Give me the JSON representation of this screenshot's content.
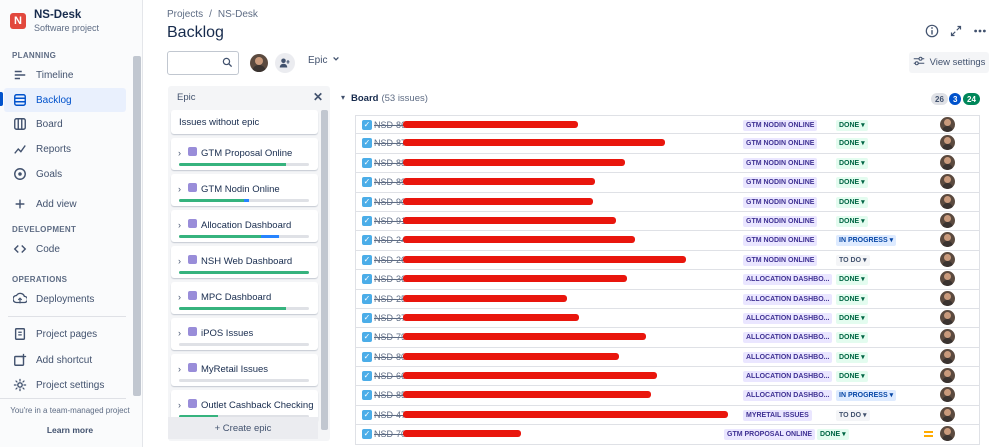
{
  "project": {
    "name": "NS-Desk",
    "type": "Software project",
    "logo_letter": "N"
  },
  "sidebar": {
    "planning_title": "PLANNING",
    "planning": [
      {
        "label": "Timeline",
        "icon": "timeline-icon"
      },
      {
        "label": "Backlog",
        "icon": "backlog-icon",
        "active": true
      },
      {
        "label": "Board",
        "icon": "board-icon"
      },
      {
        "label": "Reports",
        "icon": "reports-icon"
      },
      {
        "label": "Goals",
        "icon": "goals-icon"
      },
      {
        "label": "Add view",
        "icon": "plus-icon"
      }
    ],
    "development_title": "DEVELOPMENT",
    "development": [
      {
        "label": "Code",
        "icon": "code-icon"
      }
    ],
    "operations_title": "OPERATIONS",
    "operations": [
      {
        "label": "Deployments",
        "icon": "deployments-icon"
      }
    ],
    "bottom": [
      {
        "label": "Project pages",
        "icon": "pages-icon"
      },
      {
        "label": "Add shortcut",
        "icon": "shortcut-icon"
      },
      {
        "label": "Project settings",
        "icon": "settings-icon"
      }
    ],
    "footer_text": "You're in a team-managed project",
    "learn_more": "Learn more"
  },
  "breadcrumb": [
    "Projects",
    "/",
    "NS-Desk"
  ],
  "page_title": "Backlog",
  "toolbar": {
    "epic_filter": "Epic",
    "view_settings": "View settings"
  },
  "epic_panel": {
    "title": "Epic",
    "without_epic": "Issues without epic",
    "epics": [
      {
        "name": "GTM Proposal Online",
        "done": 0.82,
        "inprogress": 0.0
      },
      {
        "name": "GTM Nodin Online",
        "done": 0.5,
        "inprogress": 0.04
      },
      {
        "name": "Allocation Dashboard",
        "done": 0.63,
        "inprogress": 0.14
      },
      {
        "name": "NSH Web Dashboard",
        "done": 1.0,
        "inprogress": 0.0
      },
      {
        "name": "MPC Dashboard",
        "done": 0.82,
        "inprogress": 0.0
      },
      {
        "name": "iPOS Issues",
        "done": 0.0,
        "inprogress": 0.0
      },
      {
        "name": "MyRetail Issues",
        "done": 0.0,
        "inprogress": 0.0
      },
      {
        "name": "Outlet Cashback Checking",
        "done": 0.3,
        "inprogress": 0.0
      }
    ],
    "create_epic": "+ Create epic"
  },
  "board": {
    "title": "Board",
    "count_text": "(53 issues)",
    "counts": {
      "todo": "26",
      "inprogress": "3",
      "done": "24"
    },
    "colors": {
      "todo": "#dfe1e6",
      "inprogress": "#0052cc",
      "done": "#00875a"
    },
    "issues": [
      {
        "key": "NSD-86",
        "epic": "GTM NODIN ONLINE",
        "status": "DONE",
        "kind": "done"
      },
      {
        "key": "NSD-87",
        "epic": "GTM NODIN ONLINE",
        "status": "DONE",
        "kind": "done"
      },
      {
        "key": "NSD-88",
        "epic": "GTM NODIN ONLINE",
        "status": "DONE",
        "kind": "done"
      },
      {
        "key": "NSD-89",
        "epic": "GTM NODIN ONLINE",
        "status": "DONE",
        "kind": "done"
      },
      {
        "key": "NSD-90",
        "epic": "GTM NODIN ONLINE",
        "status": "DONE",
        "kind": "done"
      },
      {
        "key": "NSD-91",
        "epic": "GTM NODIN ONLINE",
        "status": "DONE",
        "kind": "done"
      },
      {
        "key": "NSD-24",
        "epic": "GTM NODIN ONLINE",
        "status": "IN PROGRESS",
        "kind": "prog"
      },
      {
        "key": "NSD-26",
        "epic": "GTM NODIN ONLINE",
        "status": "TO DO",
        "kind": "todo"
      },
      {
        "key": "NSD-36",
        "epic": "ALLOCATION DASHBO...",
        "status": "DONE",
        "kind": "done"
      },
      {
        "key": "NSD-25",
        "epic": "ALLOCATION DASHBO...",
        "status": "DONE",
        "kind": "done"
      },
      {
        "key": "NSD-37",
        "epic": "ALLOCATION DASHBO...",
        "status": "DONE",
        "kind": "done"
      },
      {
        "key": "NSD-79",
        "epic": "ALLOCATION DASHBO...",
        "status": "DONE",
        "kind": "done"
      },
      {
        "key": "NSD-80",
        "epic": "ALLOCATION DASHBO...",
        "status": "DONE",
        "kind": "done"
      },
      {
        "key": "NSD-66",
        "epic": "ALLOCATION DASHBO...",
        "status": "DONE",
        "kind": "done"
      },
      {
        "key": "NSD-85",
        "epic": "ALLOCATION DASHBO...",
        "status": "IN PROGRESS",
        "kind": "prog"
      },
      {
        "key": "NSD-47",
        "epic": "MYRETAIL ISSUES",
        "status": "TO DO",
        "kind": "todo"
      },
      {
        "key": "NSD-70",
        "epic": "GTM PROPOSAL ONLINE",
        "status": "DONE",
        "kind": "done",
        "priority": "medium"
      }
    ]
  }
}
